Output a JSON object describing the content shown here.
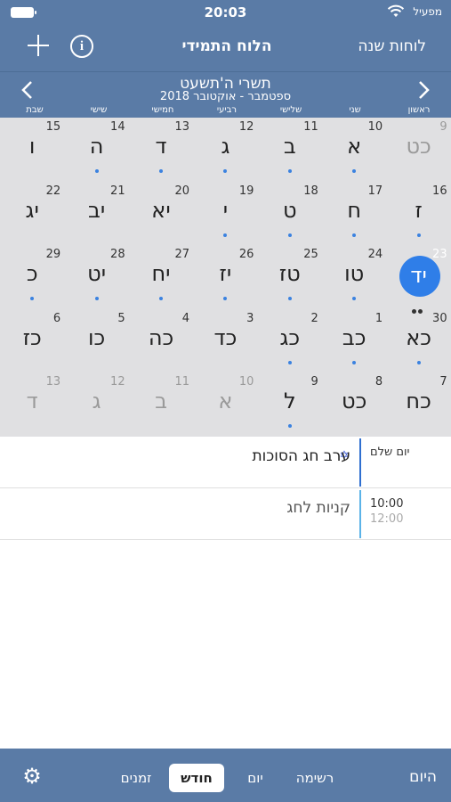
{
  "status": {
    "time": "20:03",
    "carrier": "מפעיל"
  },
  "nav": {
    "title": "הלוח התמידי",
    "year_link": "לוחות שנה",
    "info_label": "i"
  },
  "month": {
    "hebrew": "תשרי ה'תשעט",
    "gregorian": "ספטמבר - אוקטובר 2018"
  },
  "weekdays": [
    "ראשון",
    "שני",
    "שלישי",
    "רביעי",
    "חמישי",
    "שישי",
    "שבת"
  ],
  "weeks": [
    [
      {
        "g": "9",
        "h": "כט",
        "dim": true,
        "dot": false
      },
      {
        "g": "10",
        "h": "א",
        "dim": false,
        "dot": true
      },
      {
        "g": "11",
        "h": "ב",
        "dim": false,
        "dot": true
      },
      {
        "g": "12",
        "h": "ג",
        "dim": false,
        "dot": true
      },
      {
        "g": "13",
        "h": "ד",
        "dim": false,
        "dot": true
      },
      {
        "g": "14",
        "h": "ה",
        "dim": false,
        "dot": true
      },
      {
        "g": "15",
        "h": "ו",
        "dim": false,
        "dot": false
      }
    ],
    [
      {
        "g": "16",
        "h": "ז",
        "dim": false,
        "dot": true
      },
      {
        "g": "17",
        "h": "ח",
        "dim": false,
        "dot": true
      },
      {
        "g": "18",
        "h": "ט",
        "dim": false,
        "dot": true
      },
      {
        "g": "19",
        "h": "י",
        "dim": false,
        "dot": true
      },
      {
        "g": "20",
        "h": "יא",
        "dim": false,
        "dot": false
      },
      {
        "g": "21",
        "h": "יב",
        "dim": false,
        "dot": false
      },
      {
        "g": "22",
        "h": "יג",
        "dim": false,
        "dot": false
      }
    ],
    [
      {
        "g": "23",
        "h": "יד",
        "dim": false,
        "dot": false,
        "today": true
      },
      {
        "g": "24",
        "h": "טו",
        "dim": false,
        "dot": true
      },
      {
        "g": "25",
        "h": "טז",
        "dim": false,
        "dot": true
      },
      {
        "g": "26",
        "h": "יז",
        "dim": false,
        "dot": true
      },
      {
        "g": "27",
        "h": "יח",
        "dim": false,
        "dot": true
      },
      {
        "g": "28",
        "h": "יט",
        "dim": false,
        "dot": true
      },
      {
        "g": "29",
        "h": "כ",
        "dim": false,
        "dot": true
      }
    ],
    [
      {
        "g": "30",
        "h": "כא",
        "dim": false,
        "dot": true
      },
      {
        "g": "1",
        "h": "כב",
        "dim": false,
        "dot": true
      },
      {
        "g": "2",
        "h": "כג",
        "dim": false,
        "dot": true
      },
      {
        "g": "3",
        "h": "כד",
        "dim": false,
        "dot": false
      },
      {
        "g": "4",
        "h": "כה",
        "dim": false,
        "dot": false
      },
      {
        "g": "5",
        "h": "כו",
        "dim": false,
        "dot": false
      },
      {
        "g": "6",
        "h": "כז",
        "dim": false,
        "dot": false
      }
    ],
    [
      {
        "g": "7",
        "h": "כח",
        "dim": false,
        "dot": false
      },
      {
        "g": "8",
        "h": "כט",
        "dim": false,
        "dot": false
      },
      {
        "g": "9",
        "h": "ל",
        "dim": false,
        "dot": true
      },
      {
        "g": "10",
        "h": "א",
        "dim": true,
        "dot": false
      },
      {
        "g": "11",
        "h": "ב",
        "dim": true,
        "dot": false
      },
      {
        "g": "12",
        "h": "ג",
        "dim": true,
        "dot": false
      },
      {
        "g": "13",
        "h": "ד",
        "dim": true,
        "dot": false
      }
    ]
  ],
  "events": [
    {
      "when": "יום שלם",
      "end": "",
      "title": "ערב חג הסוכות",
      "bar_color": "#2f6fd0",
      "star": true
    },
    {
      "when": "10:00",
      "end": "12:00",
      "title": "קניות לחג",
      "bar_color": "#5bb3e8",
      "star": false
    }
  ],
  "tabs": {
    "today": "היום",
    "list": "רשימה",
    "day": "יום",
    "month": "חודש",
    "times": "זמנים"
  },
  "colors": {
    "accent": "#5a7ba6",
    "today_circle": "#2f7ee8",
    "dot": "#3b82e0"
  }
}
